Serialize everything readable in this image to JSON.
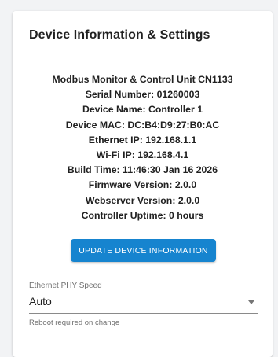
{
  "card": {
    "title": "Device Information & Settings"
  },
  "device_info": [
    "Modbus Monitor & Control Unit CN1133",
    "Serial Number: 01260003",
    "Device Name: Controller 1",
    "Device MAC: DC:B4:D9:27:B0:AC",
    "Ethernet IP: 192.168.1.1",
    "Wi-Fi IP: 192.168.4.1",
    "Build Time: 11:46:30 Jan 16 2026",
    "Firmware Version: 2.0.0",
    "Webserver Version: 2.0.0",
    "Controller Uptime: 0 hours"
  ],
  "update_button": {
    "label": "UPDATE DEVICE INFORMATION"
  },
  "ethernet_phy_speed": {
    "label": "Ethernet PHY Speed",
    "value": "Auto",
    "helper": "Reboot required on change"
  },
  "colors": {
    "accent": "#1684cf",
    "text": "#212121",
    "muted": "#6f6f6f",
    "background": "#f2f3f5",
    "card": "#ffffff"
  }
}
